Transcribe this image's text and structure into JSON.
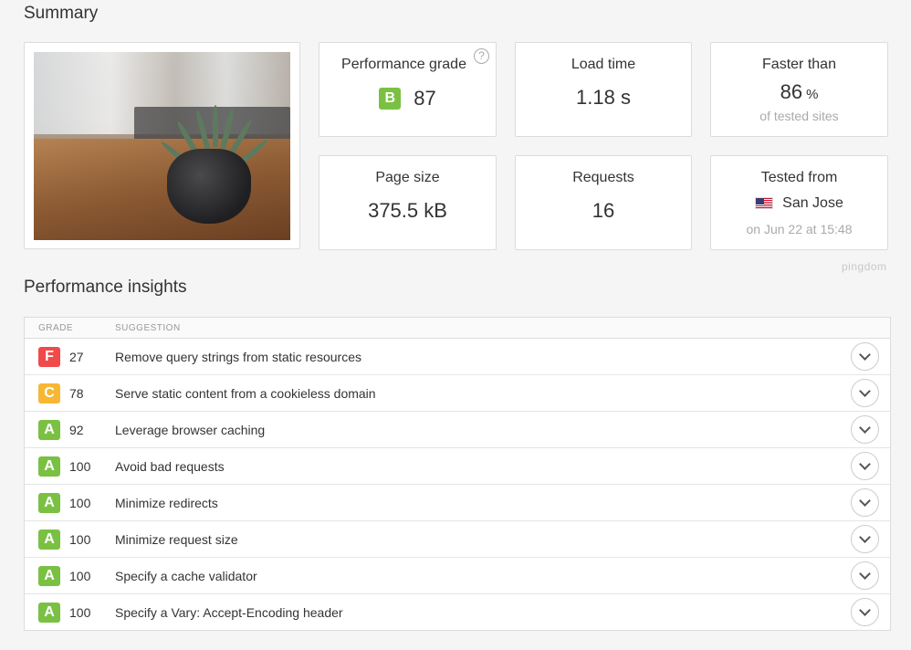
{
  "colors": {
    "grade_A": "#7ac143",
    "grade_B": "#7ac143",
    "grade_C": "#f7b733",
    "grade_F": "#f04a4a"
  },
  "summary": {
    "title": "Summary",
    "performance_grade": {
      "label": "Performance grade",
      "grade": "B",
      "value": "87",
      "help": "?"
    },
    "load_time": {
      "label": "Load time",
      "value": "1.18 s"
    },
    "faster_than": {
      "label": "Faster than",
      "value": "86",
      "unit": "%",
      "sub": "of tested sites"
    },
    "page_size": {
      "label": "Page size",
      "value": "375.5 kB"
    },
    "requests": {
      "label": "Requests",
      "value": "16"
    },
    "tested_from": {
      "label": "Tested from",
      "location": "San Jose",
      "sub": "on Jun 22 at 15:48"
    }
  },
  "brand": "pingdom",
  "insights": {
    "title": "Performance insights",
    "headers": {
      "grade": "GRADE",
      "suggestion": "SUGGESTION"
    },
    "rows": [
      {
        "grade": "F",
        "score": "27",
        "suggestion": "Remove query strings from static resources"
      },
      {
        "grade": "C",
        "score": "78",
        "suggestion": "Serve static content from a cookieless domain"
      },
      {
        "grade": "A",
        "score": "92",
        "suggestion": "Leverage browser caching"
      },
      {
        "grade": "A",
        "score": "100",
        "suggestion": "Avoid bad requests"
      },
      {
        "grade": "A",
        "score": "100",
        "suggestion": "Minimize redirects"
      },
      {
        "grade": "A",
        "score": "100",
        "suggestion": "Minimize request size"
      },
      {
        "grade": "A",
        "score": "100",
        "suggestion": "Specify a cache validator"
      },
      {
        "grade": "A",
        "score": "100",
        "suggestion": "Specify a Vary: Accept-Encoding header"
      }
    ]
  }
}
